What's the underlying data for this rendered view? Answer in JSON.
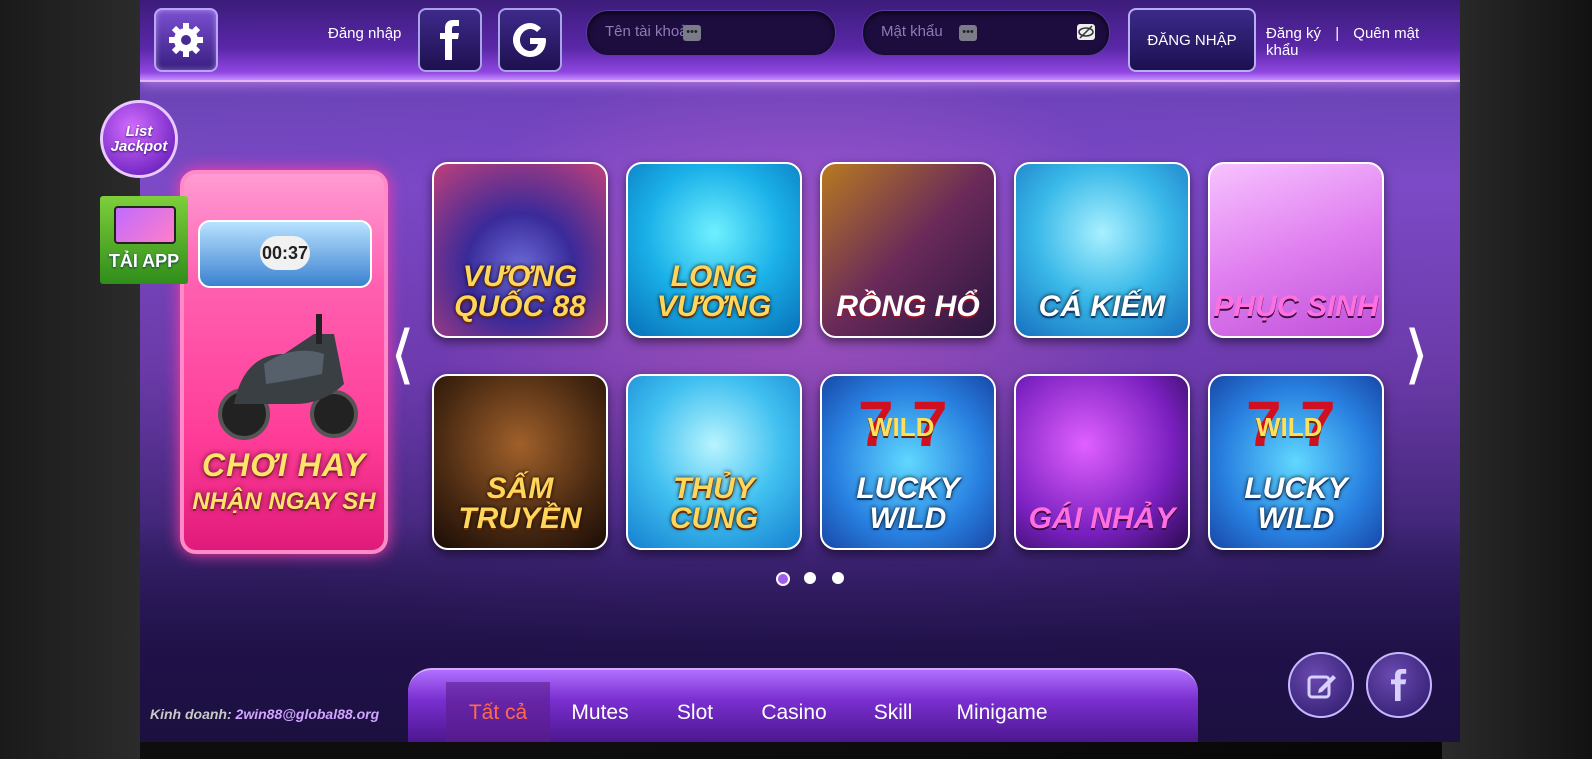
{
  "header": {
    "login_label": "Đăng nhập",
    "username_placeholder": "Tên tài khoản",
    "password_placeholder": "Mật khẩu",
    "login_button": "ĐĂNG NHẬP",
    "register_link": "Đăng ký",
    "separator": "|",
    "forgot_link": "Quên mật khẩu"
  },
  "side": {
    "jackpot_line1": "List",
    "jackpot_line2": "Jackpot",
    "app_label": "TẢI APP"
  },
  "promo": {
    "timer": "00:37",
    "line1": "CHƠI HAY",
    "line2": "NHẬN NGAY SH"
  },
  "games": [
    {
      "title": "VƯƠNG QUỐC 88"
    },
    {
      "title": "LONG VƯƠNG"
    },
    {
      "title": "RỒNG HỔ"
    },
    {
      "title": "CÁ KIẾM"
    },
    {
      "title": "PHỤC SINH"
    },
    {
      "title": "SẤM TRUYỀN"
    },
    {
      "title": "THỦY CUNG"
    },
    {
      "title": "LUCKY WILD"
    },
    {
      "title": "GÁI NHẢY"
    },
    {
      "title": "LUCKY WILD"
    }
  ],
  "wild_label": "WILD",
  "nav": {
    "tabs": [
      "Tất cả",
      "Mutes",
      "Slot",
      "Casino",
      "Skill",
      "Minigame"
    ],
    "active_tab": "Tất cả"
  },
  "footer": {
    "business_label": "Kinh doanh:",
    "business_email": "2win88@global88.org"
  },
  "carousel": {
    "page_count": 3,
    "active_page": 1
  },
  "colors": {
    "accent": "#7c4ac6",
    "active_tab": "#ff6a4a",
    "promo": "#ff3d98"
  }
}
